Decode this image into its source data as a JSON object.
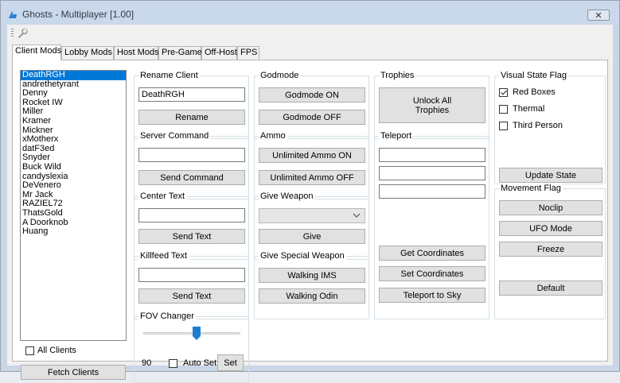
{
  "window": {
    "title": "Ghosts - Multiplayer [1.00]",
    "close_glyph": "✕"
  },
  "toolbar": {
    "icon": "wrench-icon"
  },
  "tabs": [
    {
      "label": "Client Mods",
      "active": true
    },
    {
      "label": "Lobby Mods"
    },
    {
      "label": "Host Mods"
    },
    {
      "label": "Pre-Game"
    },
    {
      "label": "Off-Host"
    },
    {
      "label": "FPS"
    }
  ],
  "clients": {
    "items": [
      "DeathRGH",
      "andrethetyrant",
      "Denny",
      "Rocket IW",
      "Miller",
      "Kramer",
      "Mickner",
      "xMotherx",
      "datF3ed",
      "Snyder",
      "Buck Wild",
      "candyslexia",
      "DeVenero",
      "Mr Jack",
      "RAZIEL72",
      "ThatsGold",
      "A Doorknob",
      "Huang"
    ],
    "selected": "DeathRGH",
    "all_clients_label": "All Clients",
    "fetch_label": "Fetch Clients"
  },
  "rename": {
    "title": "Rename Client",
    "value": "DeathRGH",
    "button": "Rename"
  },
  "server_command": {
    "title": "Server Command",
    "value": "",
    "button": "Send Command"
  },
  "center_text": {
    "title": "Center Text",
    "value": "",
    "button": "Send Text"
  },
  "killfeed": {
    "title": "Killfeed Text",
    "value": "",
    "button": "Send Text"
  },
  "fov": {
    "title": "FOV Changer",
    "value": "90",
    "auto_set_label": "Auto Set",
    "set_button": "Set",
    "level": 0.55
  },
  "godmode": {
    "title": "Godmode",
    "on": "Godmode ON",
    "off": "Godmode OFF"
  },
  "ammo": {
    "title": "Ammo",
    "on": "Unlimited Ammo ON",
    "off": "Unlimited Ammo OFF"
  },
  "give_weapon": {
    "title": "Give Weapon",
    "selected": "",
    "button": "Give"
  },
  "special_weapon": {
    "title": "Give Special Weapon",
    "ims": "Walking IMS",
    "odin": "Walking Odin"
  },
  "trophies": {
    "title": "Trophies",
    "button_line1": "Unlock All",
    "button_line2": "Trophies"
  },
  "teleport": {
    "title": "Teleport",
    "x": "",
    "y": "",
    "z": "",
    "get": "Get Coordinates",
    "set": "Set Coordinates",
    "sky": "Teleport to Sky"
  },
  "visual_state": {
    "title": "Visual State Flag",
    "red_boxes": "Red Boxes",
    "red_boxes_checked": true,
    "thermal": "Thermal",
    "third_person": "Third Person",
    "update": "Update State"
  },
  "movement": {
    "title": "Movement Flag",
    "noclip": "Noclip",
    "ufo": "UFO Mode",
    "freeze": "Freeze",
    "default": "Default"
  },
  "colors": {
    "selection": "#0078d7",
    "titlebar": "#c9d8ea",
    "accent_blue": "#1e7fd2"
  }
}
